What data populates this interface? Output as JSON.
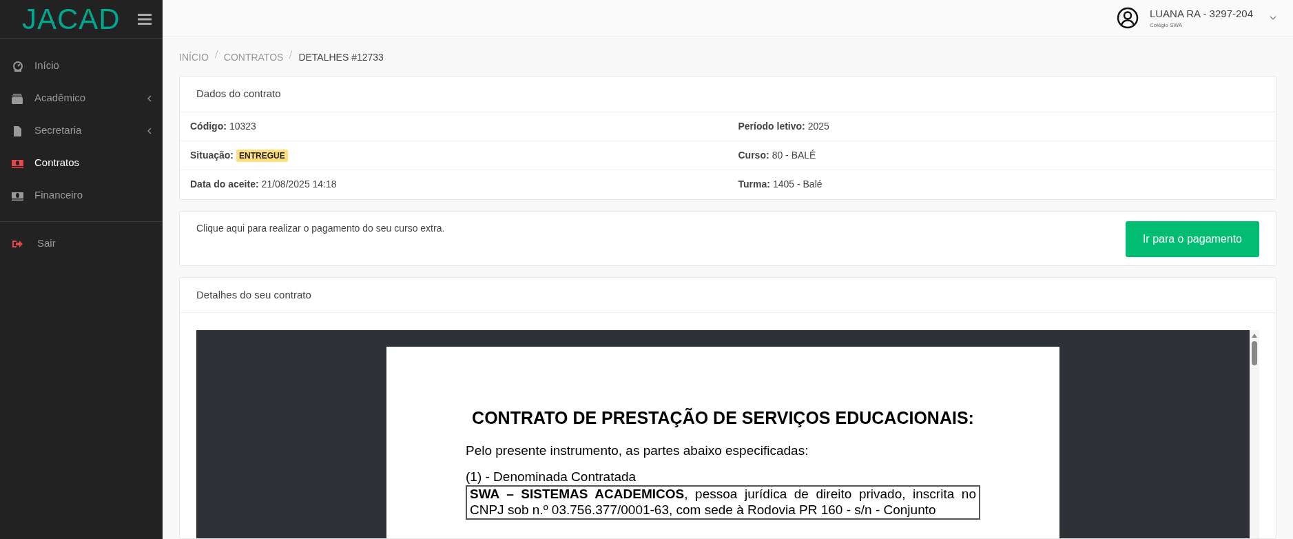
{
  "logo": "JACAD",
  "sidebar": {
    "items": [
      {
        "label": "Início",
        "selected": false,
        "expandable": false
      },
      {
        "label": "Acadêmico",
        "selected": false,
        "expandable": true
      },
      {
        "label": "Secretaria",
        "selected": false,
        "expandable": true
      },
      {
        "label": "Contratos",
        "selected": true,
        "expandable": false
      },
      {
        "label": "Financeiro",
        "selected": false,
        "expandable": false
      }
    ],
    "logout": "Sair"
  },
  "user": {
    "name": "LUANA RA - 3297-204",
    "school": "Colégio SWA"
  },
  "breadcrumb": [
    {
      "label": "INÍCIO",
      "selected": false
    },
    {
      "label": "CONTRATOS",
      "selected": false
    },
    {
      "label": "DETALHES #12733",
      "selected": true
    }
  ],
  "contract_card": {
    "title": "Dados do contrato",
    "rows": [
      [
        {
          "label": "Código:",
          "value": "10323",
          "kind": "text"
        },
        {
          "label": "Período letivo:",
          "value": "2025",
          "kind": "text"
        }
      ],
      [
        {
          "label": "Situação:",
          "value": "ENTREGUE",
          "kind": "badge"
        },
        {
          "label": "Curso:",
          "value": "80 - BALÉ",
          "kind": "text"
        }
      ],
      [
        {
          "label": "Data do aceite:",
          "value": "21/08/2025 14:18",
          "kind": "text"
        },
        {
          "label": "Turma:",
          "value": "1405 - Balé",
          "kind": "text"
        }
      ]
    ]
  },
  "payment_card": {
    "text": "Clique aqui para realizar o pagamento do seu curso extra.",
    "button": "Ir para o pagamento"
  },
  "details_card": {
    "title": "Detalhes do seu contrato",
    "document": {
      "title": "CONTRATO DE PRESTAÇÃO DE SERVIÇOS EDUCACIONAIS:",
      "intro": "Pelo presente instrumento, as partes abaixo especificadas:",
      "party_label": "(1) - Denominada Contratada",
      "party_text": "**SWA – SISTEMAS ACADEMICOS**, pessoa jurídica de direito privado, inscrita no CNPJ sob n.º 03.756.377/0001-63, com sede à Rodovia PR 160 - s/n - Conjunto"
    }
  }
}
